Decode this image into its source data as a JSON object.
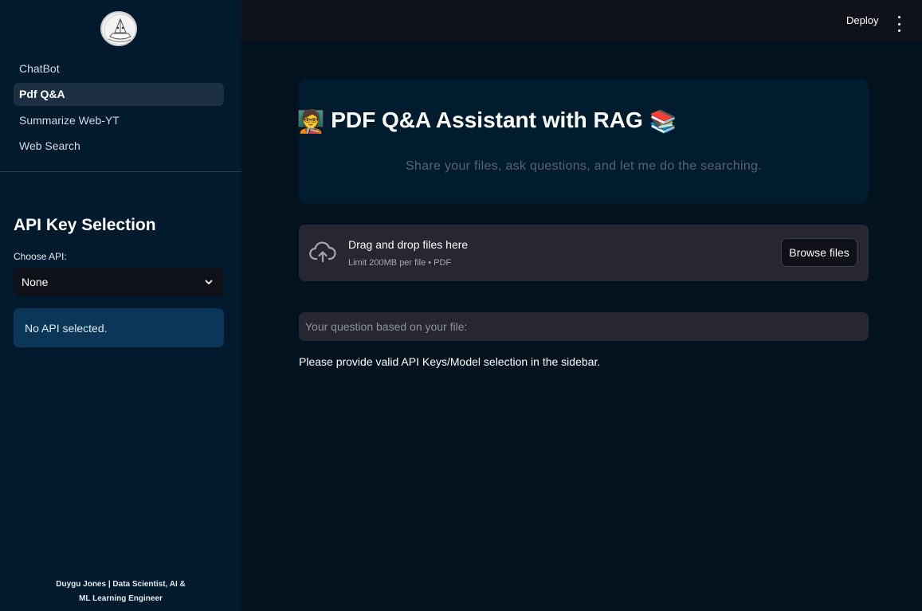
{
  "sidebar": {
    "nav_items": [
      {
        "label": "ChatBot",
        "active": false
      },
      {
        "label": "Pdf Q&A",
        "active": true
      },
      {
        "label": "Summarize Web-YT",
        "active": false
      },
      {
        "label": "Web Search",
        "active": false
      }
    ],
    "api_section_title": "API Key Selection",
    "choose_api_label": "Choose API:",
    "selected_api": "None",
    "status_message": "No API selected.",
    "footer_line1": "Duygu Jones | Data Scientist, AI &",
    "footer_line2": "ML Learning Engineer"
  },
  "topbar": {
    "deploy_label": "Deploy",
    "menu_icon": "more-vertical-icon"
  },
  "main": {
    "title": "PDF Q&A Assistant with RAG",
    "title_emoji_left": "🧑‍🏫",
    "title_emoji_right": "📚",
    "subtitle": "Share your files, ask questions, and let me do the searching.",
    "uploader": {
      "icon": "cloud-upload-icon",
      "title": "Drag and drop files here",
      "limit_text": "Limit 200MB per file • PDF",
      "browse_label": "Browse files"
    },
    "question_placeholder": "Your question based on your file:",
    "notice": "Please provide valid API Keys/Model selection in the sidebar."
  },
  "colors": {
    "sidebar_bg": "#011a2d",
    "main_bg": "#02121f",
    "topbar_bg": "#0f1219",
    "alert_bg": "#0c3657",
    "input_bg": "#262730"
  }
}
